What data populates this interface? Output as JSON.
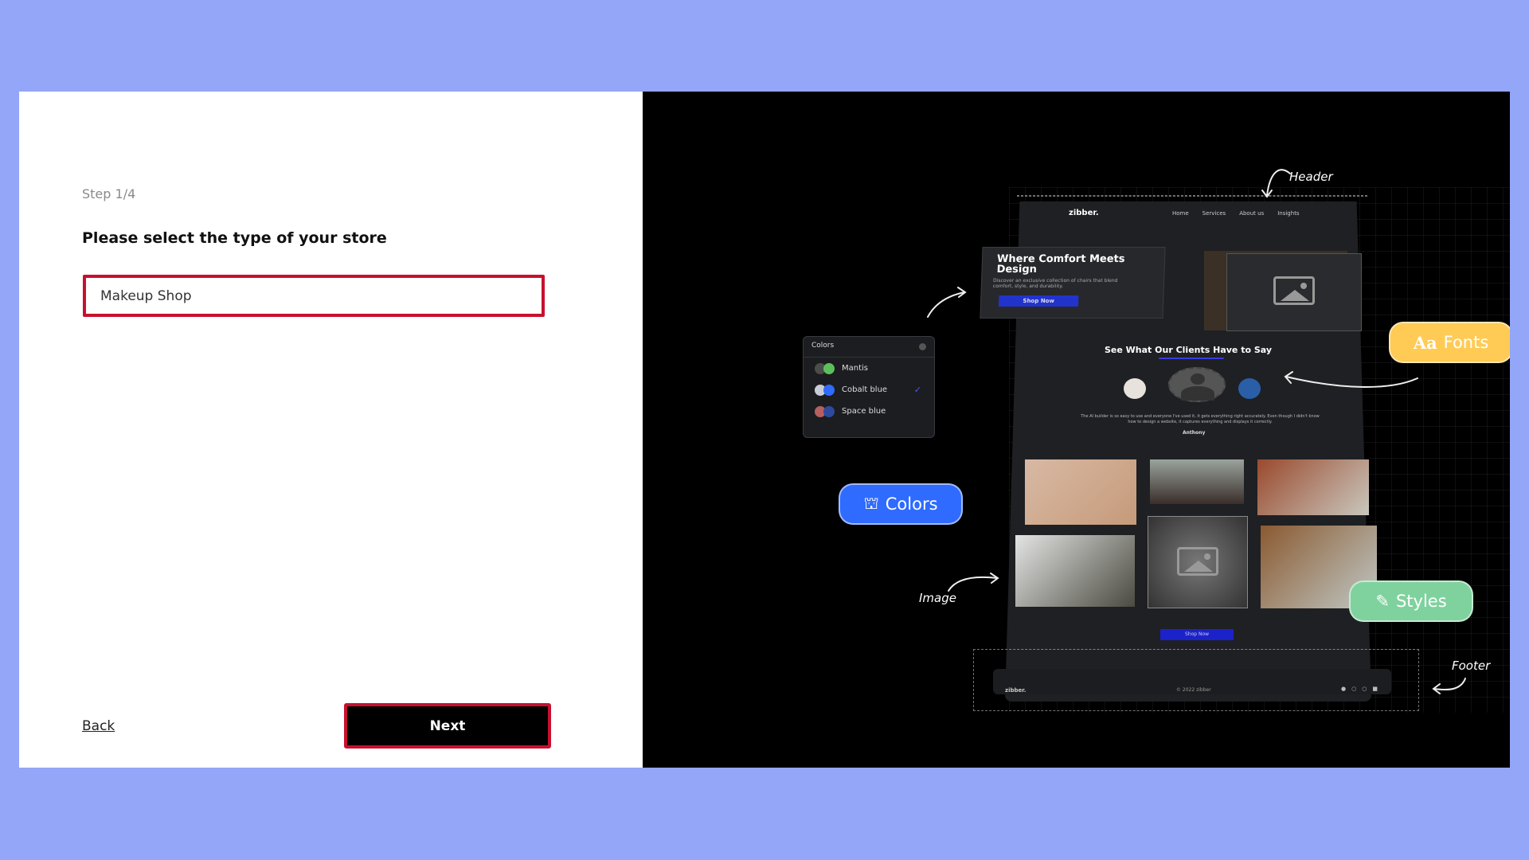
{
  "wizard": {
    "step_label": "Step 1/4",
    "question": "Please select the type of your store",
    "store_type_value": "Makeup Shop",
    "back_label": "Back",
    "next_label": "Next",
    "highlight_color": "#c8102e"
  },
  "preview": {
    "annotations": {
      "header": "Header",
      "image": "Image",
      "footer": "Footer"
    },
    "badges": {
      "colors": "Colors",
      "fonts": "Fonts",
      "fonts_glyph": "Aa",
      "styles": "Styles"
    },
    "colors_panel": {
      "title": "Colors",
      "options": [
        {
          "name": "Mantis",
          "color_a": "#4a4d4a",
          "color_b": "#5cc05a",
          "selected": false
        },
        {
          "name": "Cobalt blue",
          "color_a": "#c9ccd6",
          "color_b": "#2f6bff",
          "selected": true
        },
        {
          "name": "Space blue",
          "color_a": "#b45f60",
          "color_b": "#2d4aa0",
          "selected": false
        }
      ]
    },
    "mockup": {
      "logo": "zibber.",
      "nav": [
        "Home",
        "Services",
        "About us",
        "Insights"
      ],
      "hero_title": "Where Comfort Meets Design",
      "hero_subtitle": "Discover an exclusive collection of chairs that blend comfort, style, and durability.",
      "hero_button": "Shop Now",
      "testimonials_title": "See What Our Clients Have to Say",
      "testimonial_text": "The AI builder is so easy to use and everyone I've used it, it gets everything right accurately. Even though I didn't know how to design a website, it captures everything and displays it correctly.",
      "testimonial_author": "Anthony",
      "shop_button": "Shop Now",
      "footer_logo": "zibber.",
      "footer_copyright": "© 2022 zibber",
      "footer_icons": [
        "twitter-icon",
        "instagram-icon",
        "facebook-icon",
        "youtube-icon"
      ]
    }
  }
}
